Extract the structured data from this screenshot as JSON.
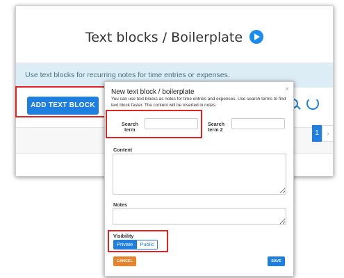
{
  "app": {
    "page_title": "Text blocks / Boilerplate",
    "info_text": "Use text blocks for recurring notes for time entries or expenses.",
    "add_button_label": "ADD TEXT BLOCK",
    "pagination": {
      "current_page": "1",
      "next_label": "›"
    }
  },
  "modal": {
    "title": "New text block / boilerplate",
    "close_label": "×",
    "description": "You can use text blocks as notes for time entries and expenses. Use search terms to find text block faster. The content will be inserted in notes.",
    "search_term_label": "Search term",
    "search_term_value": "",
    "search_term2_label": "Search term 2",
    "search_term2_value": "",
    "content_label": "Content",
    "content_value": "",
    "notes_label": "Notes",
    "notes_value": "",
    "visibility_label": "Visibility",
    "visibility_options": [
      "Private",
      "Public"
    ],
    "visibility_selected": "Private",
    "cancel_label": "CANCEL",
    "save_label": "SAVE"
  },
  "colors": {
    "accent": "#1f7fe0",
    "cancel": "#e8822c",
    "highlight": "#e52222",
    "info_bar": "#dcedf5"
  },
  "icons": [
    "play-icon",
    "search-icon",
    "refresh-icon",
    "close-icon"
  ]
}
